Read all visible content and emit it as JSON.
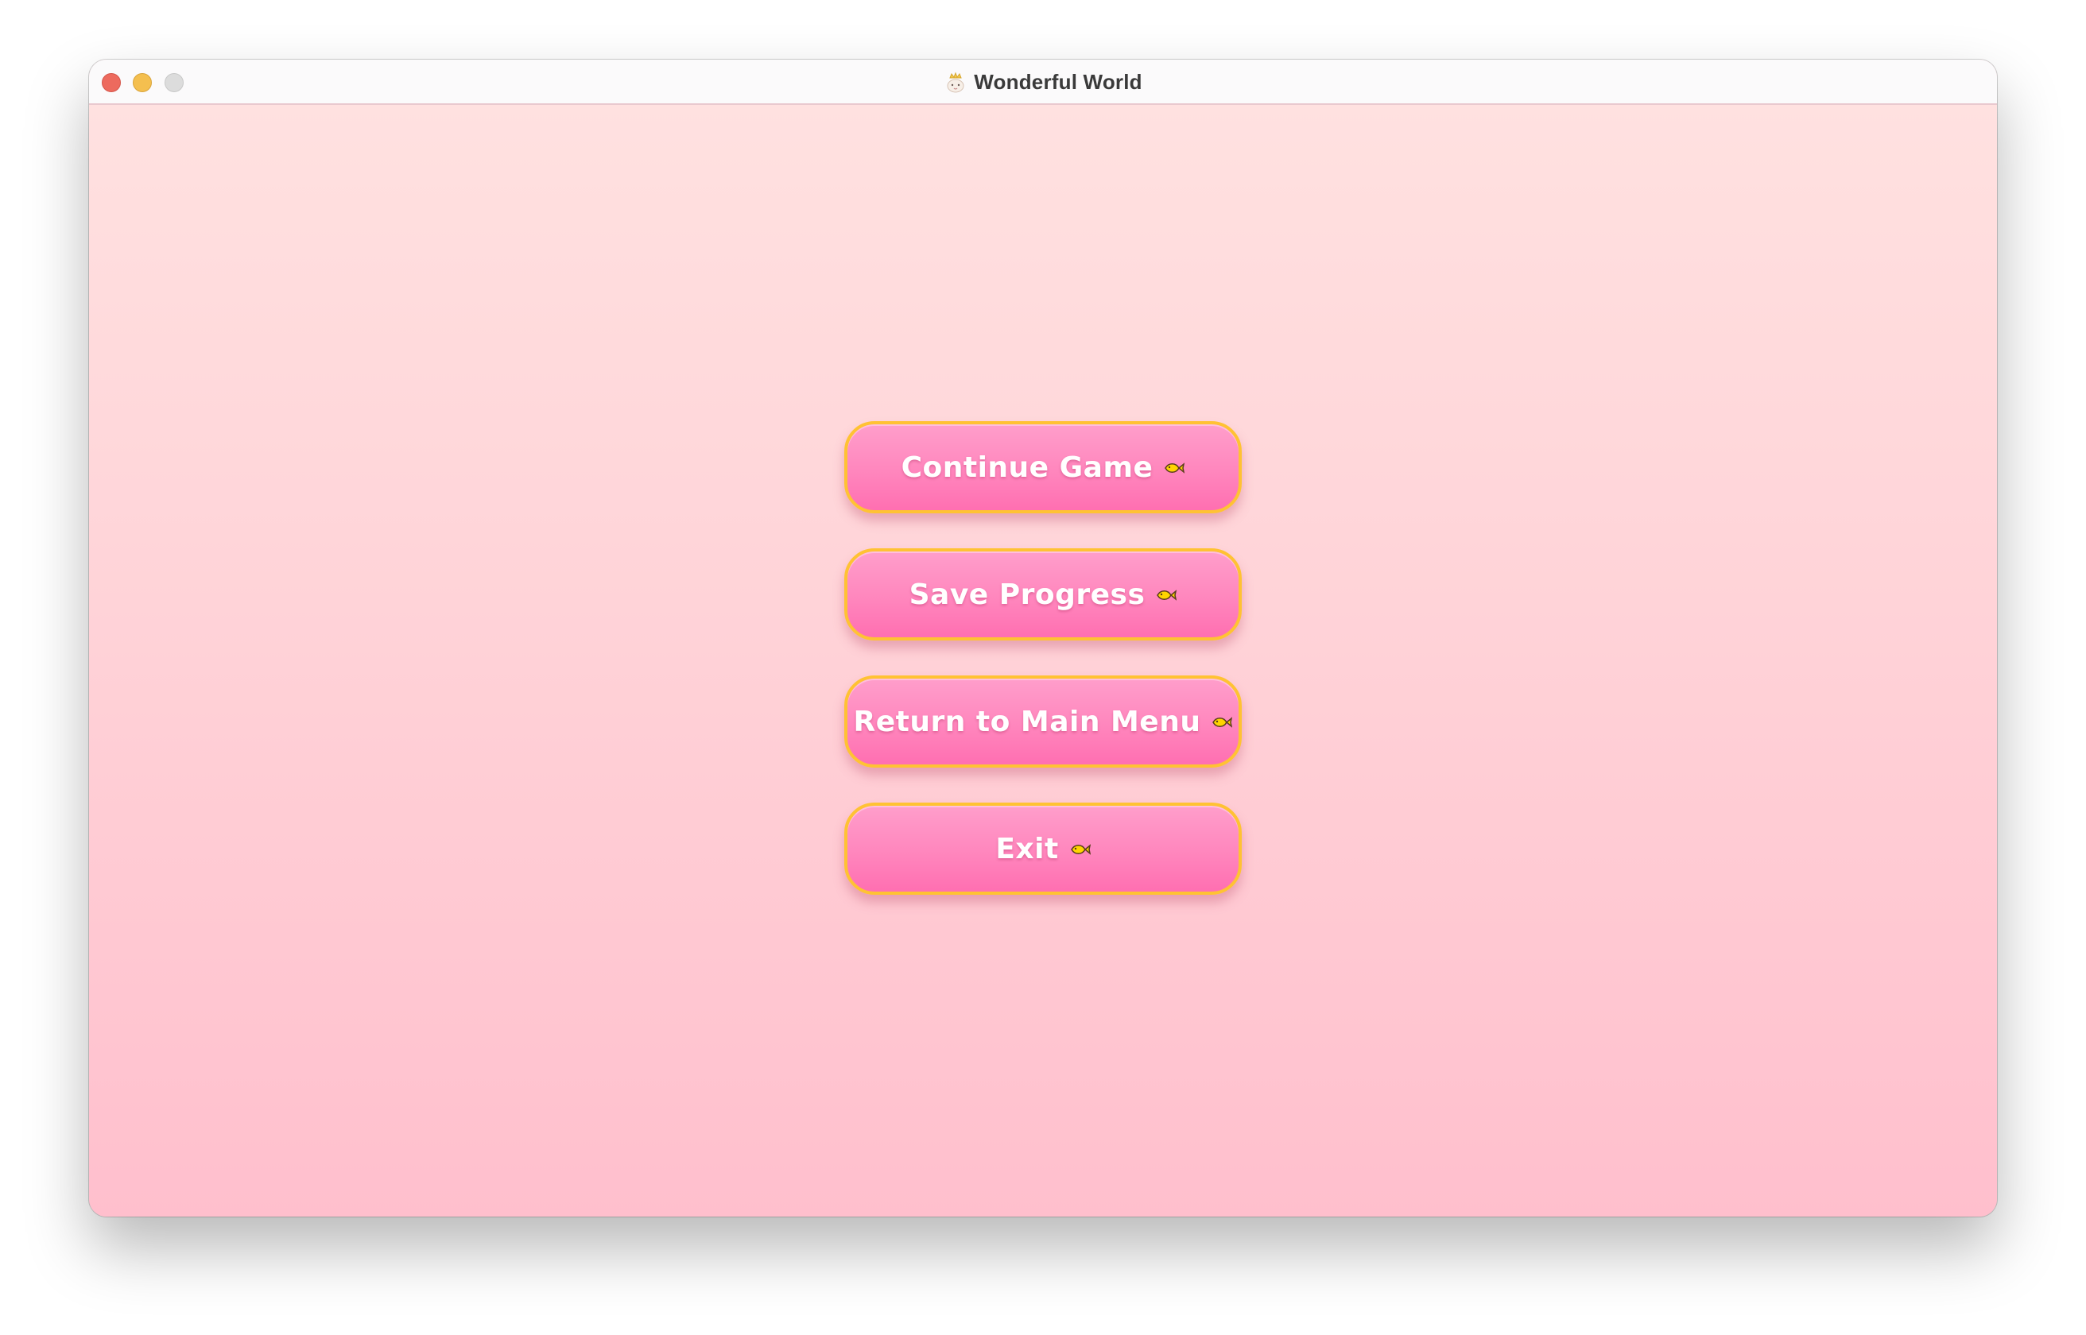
{
  "window": {
    "title": "Wonderful World",
    "app_icon": "crowned-bunny-icon"
  },
  "menu": {
    "items": [
      {
        "label": "Continue Game",
        "icon": "fish-icon"
      },
      {
        "label": "Save Progress",
        "icon": "fish-icon"
      },
      {
        "label": "Return to Main Menu",
        "icon": "fish-icon"
      },
      {
        "label": "Exit",
        "icon": "fish-icon"
      }
    ]
  },
  "colors": {
    "button_fill": "#ff86bd",
    "button_border": "#ffc233",
    "background_top": "#ffe1e0",
    "background_bottom": "#ffbfcd",
    "close": "#ed6a5e",
    "minimize": "#f4bf4f",
    "zoom": "#dcdcdc"
  }
}
